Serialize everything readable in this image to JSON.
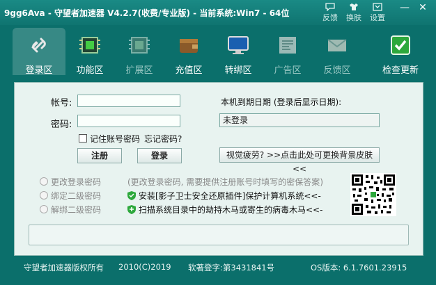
{
  "window": {
    "title": "9gg6Ava - 守望者加速器 V4.2.7(收费/专业版) - 当前系统:Win7 - 64位",
    "tools": [
      {
        "label": "反馈",
        "icon": "feedback-icon"
      },
      {
        "label": "换肤",
        "icon": "skin-icon"
      },
      {
        "label": "设置",
        "icon": "settings-icon"
      }
    ],
    "minimize": "—",
    "close": "✕"
  },
  "nav": [
    {
      "label": "登录区",
      "icon": "link-icon",
      "active": true
    },
    {
      "label": "功能区",
      "icon": "chip-icon"
    },
    {
      "label": "扩展区",
      "icon": "chip-dim-icon"
    },
    {
      "label": "充值区",
      "icon": "wallet-icon"
    },
    {
      "label": "转绑区",
      "icon": "monitor-icon"
    },
    {
      "label": "广告区",
      "icon": "news-icon"
    },
    {
      "label": "反馈区",
      "icon": "mail-icon"
    },
    {
      "label": "检查更新",
      "icon": "check-update-icon"
    }
  ],
  "login": {
    "account_label": "帐号:",
    "password_label": "密码:",
    "account_value": "",
    "password_value": "",
    "remember_label": "记住账号密码",
    "forgot_label": "忘记密码?",
    "register_label": "注册",
    "login_label": "登录"
  },
  "expiry": {
    "label": "本机到期日期 (登录后显示日期):",
    "value": "未登录"
  },
  "skin_button": "视觉疲劳? >>点击此处可更换背景皮肤<<",
  "options": [
    {
      "label": "更改登录密码"
    },
    {
      "label": "绑定二级密码"
    },
    {
      "label": "解绑二级密码"
    }
  ],
  "hint": "(更改登录密码, 需要提供注册账号时填写的密保答案)",
  "links": [
    "安装[影子卫士安全还原插件]保护计算机系统<<-",
    "扫描系统目录中的劫持木马或寄生的病毒木马<<-"
  ],
  "footer": {
    "copyright": "守望者加速器版权所有",
    "years": "2010(C)2019",
    "reg": "软著登字:第3431841号",
    "os": "OS版本: 6.1.7601.23915"
  },
  "colors": {
    "theme": "#0b6f6b",
    "accent_green": "#2da83c"
  }
}
